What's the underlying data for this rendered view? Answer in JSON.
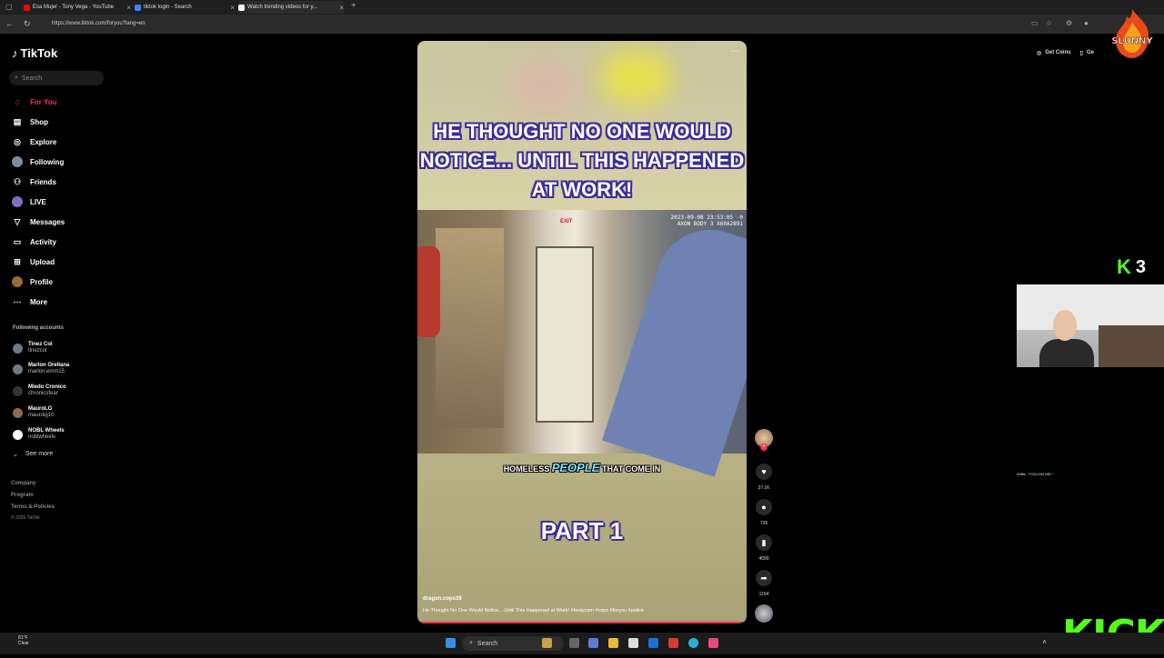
{
  "browser": {
    "tabs": [
      {
        "title": "Esa Mujer - Tony Vega - YouTube",
        "color": "#ff0000"
      },
      {
        "title": "tiktok login - Search",
        "color": "#3b82f6"
      },
      {
        "title": "Watch trending videos for y...",
        "color": "#ffffff"
      }
    ],
    "url": "https://www.tiktok.com/foryou?lang=en"
  },
  "sidebar": {
    "logo": "TikTok",
    "search_placeholder": "Search",
    "nav": [
      {
        "label": "For You",
        "icon": "home-icon"
      },
      {
        "label": "Shop",
        "icon": "shop-icon"
      },
      {
        "label": "Explore",
        "icon": "compass-icon"
      },
      {
        "label": "Following",
        "icon": "following-icon"
      },
      {
        "label": "Friends",
        "icon": "friends-icon"
      },
      {
        "label": "LIVE",
        "icon": "live-icon"
      },
      {
        "label": "Messages",
        "icon": "messages-icon"
      },
      {
        "label": "Activity",
        "icon": "activity-icon"
      },
      {
        "label": "Upload",
        "icon": "upload-icon"
      },
      {
        "label": "Profile",
        "icon": "profile-icon"
      },
      {
        "label": "More",
        "icon": "more-icon"
      }
    ],
    "following_title": "Following accounts",
    "accounts": [
      {
        "name": "Tinez Col",
        "handle": "tinezcol"
      },
      {
        "name": "Marlon Orellana",
        "handle": "marlon.emm15"
      },
      {
        "name": "Miedo Cronico",
        "handle": "chronicsfear"
      },
      {
        "name": "MauroLG",
        "handle": "mauroig10"
      },
      {
        "name": "NOBL Wheels",
        "handle": "noblwheels"
      }
    ],
    "see_more": "See more",
    "footer": [
      "Company",
      "Program",
      "Terms & Policies",
      "© 2025 TikTok"
    ]
  },
  "video": {
    "headline": "HE THOUGHT NO ONE WOULD NOTICE... UNTIL THIS HAPPENED AT WORK!",
    "timestamp": "2023-09-08 23:53:05 -0\nAXON BODY 3 X60A2891",
    "exit_sign": "EXIT",
    "subtitle_pre": "HOMELESS",
    "subtitle_hl": "PEOPLE",
    "subtitle_post": "THAT COME IN",
    "part": "PART 1",
    "author": "dragon.cops38",
    "caption": "He Thought No One Would Notice... Until This Happened at Work! #bodycam #cops #foryou #police",
    "progress": 0.98
  },
  "actions": {
    "likes": "37.1K",
    "comments": "726",
    "saves": "4090",
    "shares": "1154"
  },
  "topright": {
    "get_coins": "Get Coins",
    "get_app": "Ge"
  },
  "stream": {
    "kick_viewers": "3",
    "follow_text": "Seffix : FOLLOW ME !",
    "kick_logo": "KICK",
    "slunny_logo": "SLUNNY"
  },
  "taskbar": {
    "weather_temp": "81°F",
    "weather_desc": "Clear",
    "search": "Search"
  }
}
